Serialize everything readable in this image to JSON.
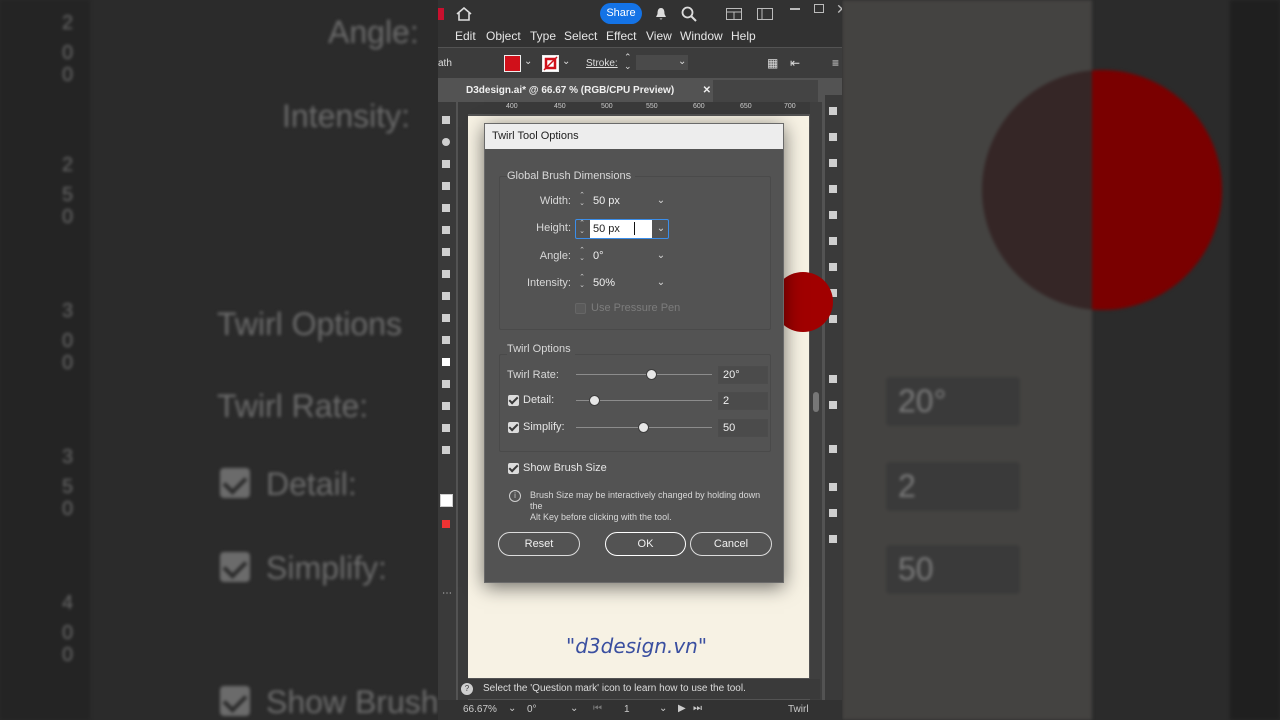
{
  "background": {
    "left": {
      "angle": "Angle:",
      "intensity": "Intensity:",
      "twirl_options": "Twirl Options",
      "twirl_rate": "Twirl Rate:",
      "detail": "Detail:",
      "simplify": "Simplify:",
      "show_brush": "Show Brush",
      "ruler_digits": [
        "2",
        "0",
        "0",
        "2",
        "5",
        "0",
        "3",
        "0",
        "0",
        "3",
        "5",
        "0",
        "4",
        "0",
        "0"
      ]
    },
    "right": {
      "twirl_rate_value": "20°",
      "detail_value": "2",
      "simplify_value": "50"
    }
  },
  "app": {
    "share_label": "Share",
    "menu": [
      "Edit",
      "Object",
      "Type",
      "Select",
      "Effect",
      "View",
      "Window",
      "Help"
    ],
    "control": {
      "left_text": "ath",
      "stroke_label": "Stroke:",
      "fill_color": "#d0101a",
      "stroke_color": "#d0101a"
    },
    "tab_title": "D3design.ai* @ 66.67 % (RGB/CPU Preview)",
    "ruler_ticks": [
      "400",
      "450",
      "500",
      "550",
      "600",
      "650",
      "700"
    ],
    "hint": "Select the 'Question mark' icon to learn how to use the tool.",
    "status": {
      "zoom": "66.67%",
      "rotate": "0°",
      "page": "1",
      "tool": "Twirl"
    },
    "watermark": "\"d3design.vn\"",
    "accent_red": "#a10000",
    "share_color": "#1473e6"
  },
  "dialog": {
    "title": "Twirl Tool Options",
    "global_section": "Global Brush Dimensions",
    "width_label": "Width:",
    "width_value": "50 px",
    "height_label": "Height:",
    "height_value": "50 px",
    "angle_label": "Angle:",
    "angle_value": "0°",
    "intensity_label": "Intensity:",
    "intensity_value": "50%",
    "pressure_label": "Use Pressure Pen",
    "twirl_section": "Twirl Options",
    "twirl_rate_label": "Twirl Rate:",
    "twirl_rate_value": "20°",
    "twirl_rate_level": 0.55,
    "detail_label": "Detail:",
    "detail_value": "2",
    "detail_level": 0.13,
    "simplify_label": "Simplify:",
    "simplify_value": "50",
    "simplify_level": 0.49,
    "show_brush_label": "Show Brush Size",
    "info_text_line1": "Brush Size may be interactively changed by holding down the",
    "info_text_line2": "Alt Key before clicking with the tool.",
    "reset_label": "Reset",
    "ok_label": "OK",
    "cancel_label": "Cancel"
  }
}
